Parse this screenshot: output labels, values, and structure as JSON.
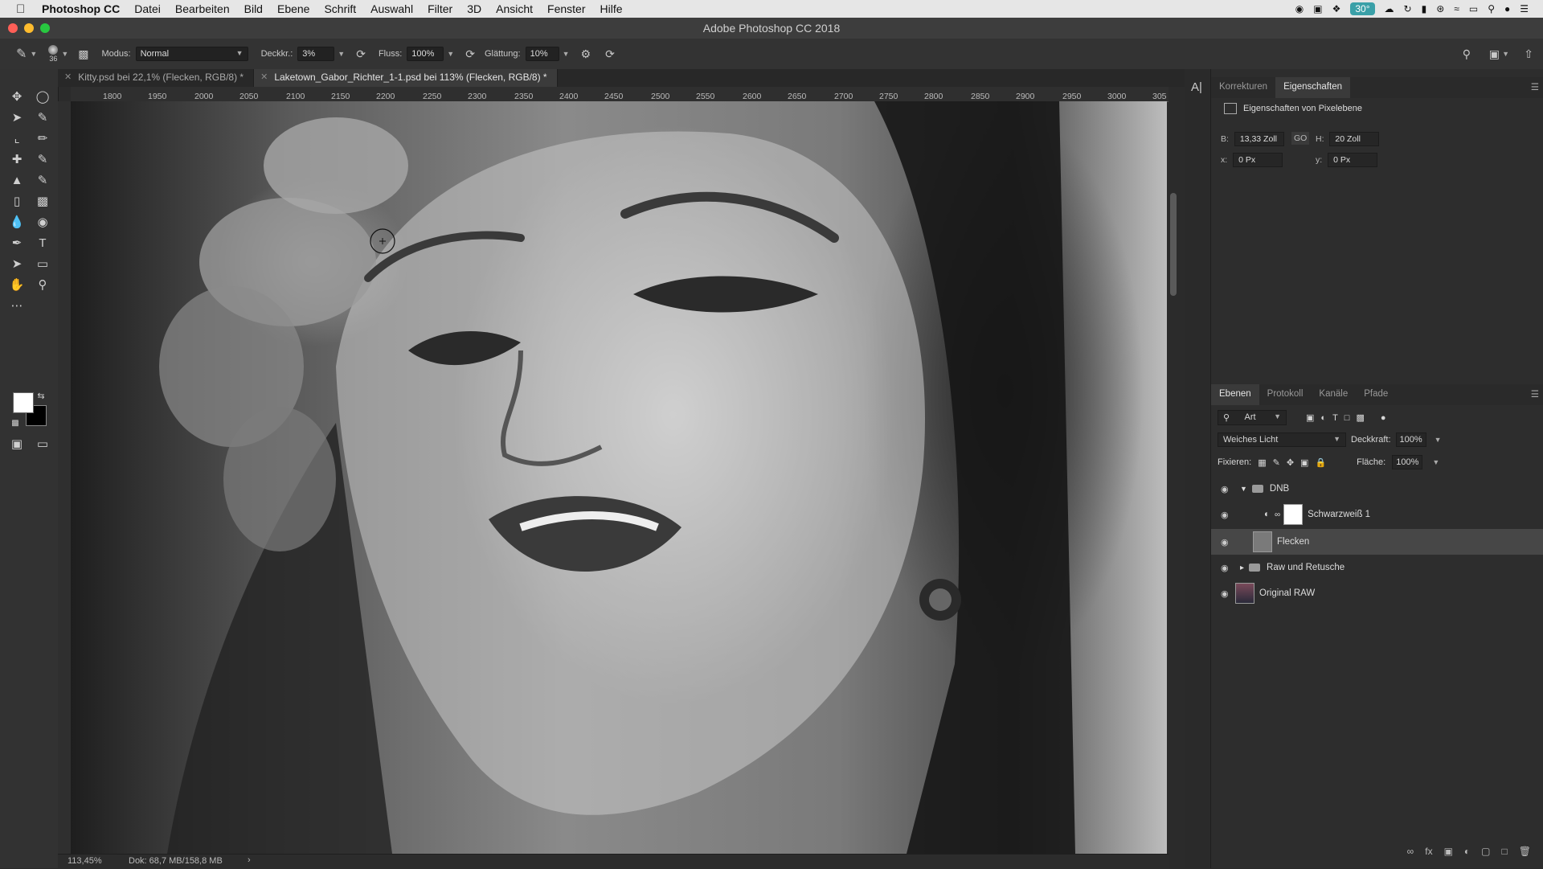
{
  "menubar": {
    "app": "Photoshop CC",
    "items": [
      "Datei",
      "Bearbeiten",
      "Bild",
      "Ebene",
      "Schrift",
      "Auswahl",
      "Filter",
      "3D",
      "Ansicht",
      "Fenster",
      "Hilfe"
    ],
    "status_badge": "30°"
  },
  "window": {
    "title": "Adobe Photoshop CC 2018"
  },
  "options": {
    "brush_size": "36",
    "mode_label": "Modus:",
    "mode_value": "Normal",
    "opacity_label": "Deckkr.:",
    "opacity_value": "3%",
    "flow_label": "Fluss:",
    "flow_value": "100%",
    "smoothing_label": "Glättung:",
    "smoothing_value": "10%"
  },
  "tabs": [
    {
      "label": "Kitty.psd bei 22,1% (Flecken, RGB/8) *",
      "active": false
    },
    {
      "label": "Laketown_Gabor_Richter_1-1.psd bei 113% (Flecken, RGB/8) *",
      "active": true
    }
  ],
  "ruler": {
    "ticks": [
      "1800",
      "1950",
      "2000",
      "2050",
      "2100",
      "2150",
      "2200",
      "2250",
      "2300",
      "2350",
      "2400",
      "2450",
      "2500",
      "2550",
      "2600",
      "2650",
      "2700",
      "2750",
      "2800",
      "2850",
      "2900",
      "2950",
      "3000",
      "305"
    ]
  },
  "statusbar": {
    "zoom": "113,45%",
    "doc": "Dok: 68,7 MB/158,8 MB"
  },
  "properties_panel": {
    "tabs": [
      "Korrekturen",
      "Eigenschaften"
    ],
    "active_tab": "Eigenschaften",
    "heading": "Eigenschaften von Pixelebene",
    "w_label": "B:",
    "w_value": "13,33 Zoll",
    "link_label": "GO",
    "h_label": "H:",
    "h_value": "20 Zoll",
    "x_label": "x:",
    "x_value": "0 Px",
    "y_label": "y:",
    "y_value": "0 Px"
  },
  "layers_panel": {
    "tabs": [
      "Ebenen",
      "Protokoll",
      "Kanäle",
      "Pfade"
    ],
    "filter_kind": "Art",
    "blend_mode": "Weiches Licht",
    "opacity_label": "Deckkraft:",
    "opacity_value": "100%",
    "lock_label": "Fixieren:",
    "fill_label": "Fläche:",
    "fill_value": "100%",
    "layers": [
      {
        "name": "DNB",
        "type": "group-open"
      },
      {
        "name": "Schwarzweiß 1",
        "type": "adjustment"
      },
      {
        "name": "Flecken",
        "type": "pixel",
        "selected": true
      },
      {
        "name": "Raw und Retusche",
        "type": "group-closed"
      },
      {
        "name": "Original RAW",
        "type": "pixel"
      }
    ]
  },
  "colors": {
    "accent": "#3aa0a8",
    "panel_bg": "#2d2d2d",
    "menubar_bg": "#e6e6e6"
  }
}
